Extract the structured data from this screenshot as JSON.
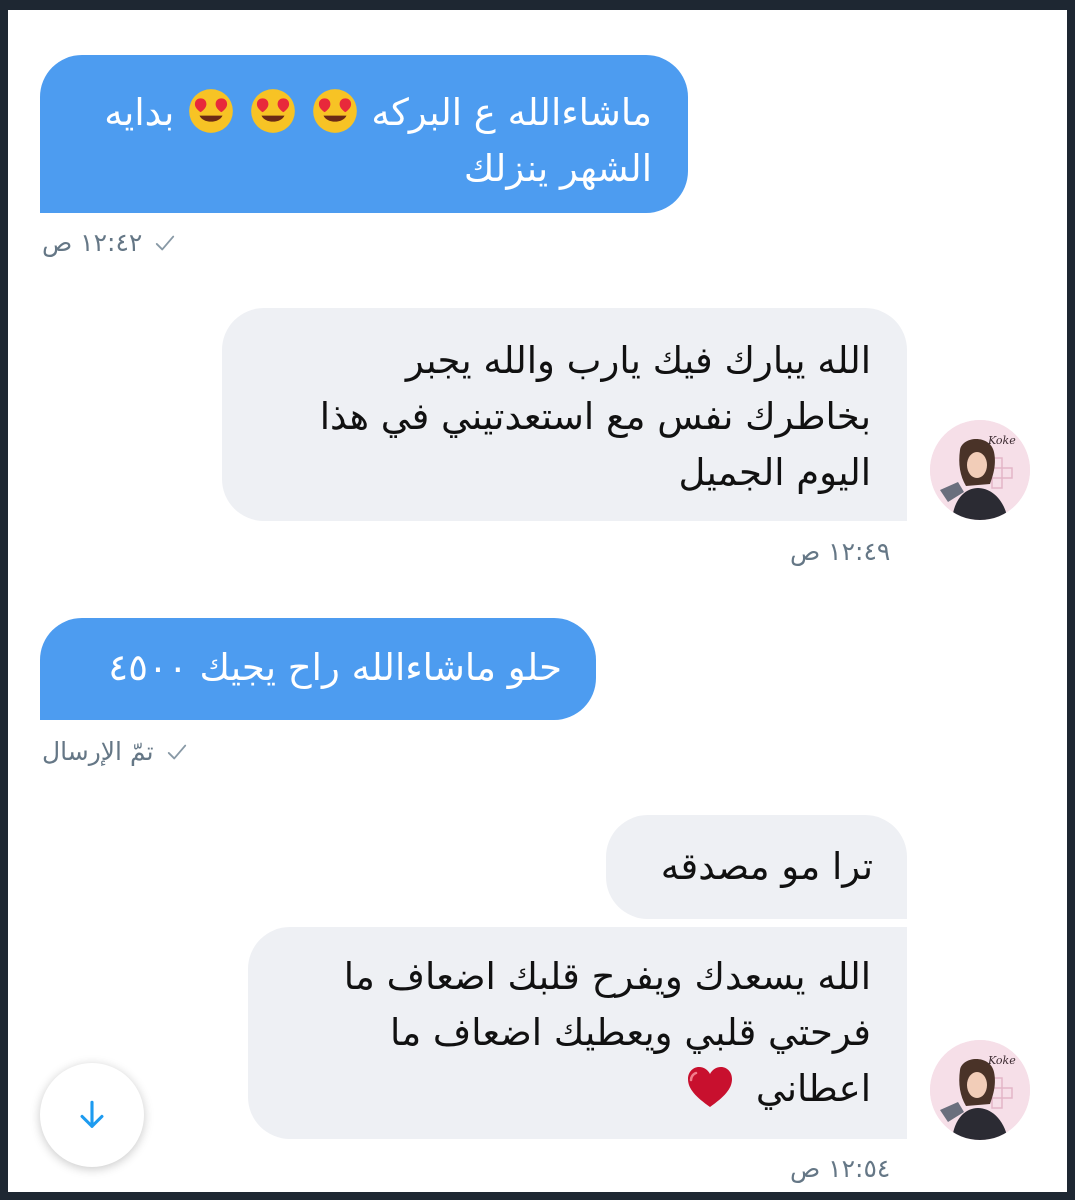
{
  "messages": [
    {
      "id": "m1",
      "direction": "sent",
      "text_main": "ماشاءالله ع البركه",
      "text_after": "بدايه",
      "line2": "الشهر ينزلك",
      "emoji_name": "smiling-face-with-heart-eyes-emoji",
      "emoji_count": 3
    },
    {
      "id": "m1_meta",
      "time": "١٢:٤٢ ص",
      "status_icon": "sent-check-icon"
    },
    {
      "id": "m2",
      "direction": "received",
      "lines": [
        "الله يبارك فيك يارب والله يجبر",
        "بخاطرك نفس مع استعدتيني في هذا",
        "اليوم الجميل"
      ],
      "time": "١٢:٤٩ ص"
    },
    {
      "id": "m3",
      "direction": "sent",
      "text": "حلو ماشاءالله راح يجيك ٤٥٠٠",
      "status": "تمّ الإرسال",
      "status_icon": "sent-check-icon"
    },
    {
      "id": "m4",
      "direction": "received",
      "text": "ترا مو مصدقه"
    },
    {
      "id": "m5",
      "direction": "received",
      "lines": [
        "الله يسعدك ويفرح قلبك اضعاف ما",
        "فرحتي قلبي ويعطيك اضعاف ما",
        "اعطاني"
      ],
      "emoji_name": "red-heart-emoji",
      "time": "١٢:٥٤ ص"
    }
  ],
  "avatar": {
    "label": "Koke",
    "background": "#f6dfe8"
  },
  "colors": {
    "sent_bubble": "#4d9cf0",
    "received_bubble": "#eef0f4",
    "meta_text": "#657786",
    "accent": "#1d9bf0",
    "frame": "#1e2732"
  },
  "scroll_button": {
    "icon": "arrow-down-icon"
  }
}
